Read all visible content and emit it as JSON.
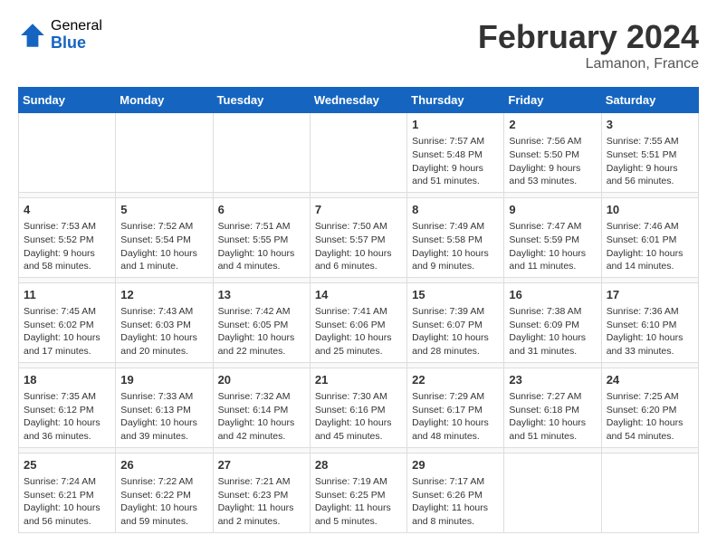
{
  "header": {
    "logo_general": "General",
    "logo_blue": "Blue",
    "title": "February 2024",
    "location": "Lamanon, France"
  },
  "columns": [
    "Sunday",
    "Monday",
    "Tuesday",
    "Wednesday",
    "Thursday",
    "Friday",
    "Saturday"
  ],
  "weeks": [
    {
      "days": [
        {
          "number": "",
          "info": ""
        },
        {
          "number": "",
          "info": ""
        },
        {
          "number": "",
          "info": ""
        },
        {
          "number": "",
          "info": ""
        },
        {
          "number": "1",
          "info": "Sunrise: 7:57 AM\nSunset: 5:48 PM\nDaylight: 9 hours\nand 51 minutes."
        },
        {
          "number": "2",
          "info": "Sunrise: 7:56 AM\nSunset: 5:50 PM\nDaylight: 9 hours\nand 53 minutes."
        },
        {
          "number": "3",
          "info": "Sunrise: 7:55 AM\nSunset: 5:51 PM\nDaylight: 9 hours\nand 56 minutes."
        }
      ]
    },
    {
      "days": [
        {
          "number": "4",
          "info": "Sunrise: 7:53 AM\nSunset: 5:52 PM\nDaylight: 9 hours\nand 58 minutes."
        },
        {
          "number": "5",
          "info": "Sunrise: 7:52 AM\nSunset: 5:54 PM\nDaylight: 10 hours\nand 1 minute."
        },
        {
          "number": "6",
          "info": "Sunrise: 7:51 AM\nSunset: 5:55 PM\nDaylight: 10 hours\nand 4 minutes."
        },
        {
          "number": "7",
          "info": "Sunrise: 7:50 AM\nSunset: 5:57 PM\nDaylight: 10 hours\nand 6 minutes."
        },
        {
          "number": "8",
          "info": "Sunrise: 7:49 AM\nSunset: 5:58 PM\nDaylight: 10 hours\nand 9 minutes."
        },
        {
          "number": "9",
          "info": "Sunrise: 7:47 AM\nSunset: 5:59 PM\nDaylight: 10 hours\nand 11 minutes."
        },
        {
          "number": "10",
          "info": "Sunrise: 7:46 AM\nSunset: 6:01 PM\nDaylight: 10 hours\nand 14 minutes."
        }
      ]
    },
    {
      "days": [
        {
          "number": "11",
          "info": "Sunrise: 7:45 AM\nSunset: 6:02 PM\nDaylight: 10 hours\nand 17 minutes."
        },
        {
          "number": "12",
          "info": "Sunrise: 7:43 AM\nSunset: 6:03 PM\nDaylight: 10 hours\nand 20 minutes."
        },
        {
          "number": "13",
          "info": "Sunrise: 7:42 AM\nSunset: 6:05 PM\nDaylight: 10 hours\nand 22 minutes."
        },
        {
          "number": "14",
          "info": "Sunrise: 7:41 AM\nSunset: 6:06 PM\nDaylight: 10 hours\nand 25 minutes."
        },
        {
          "number": "15",
          "info": "Sunrise: 7:39 AM\nSunset: 6:07 PM\nDaylight: 10 hours\nand 28 minutes."
        },
        {
          "number": "16",
          "info": "Sunrise: 7:38 AM\nSunset: 6:09 PM\nDaylight: 10 hours\nand 31 minutes."
        },
        {
          "number": "17",
          "info": "Sunrise: 7:36 AM\nSunset: 6:10 PM\nDaylight: 10 hours\nand 33 minutes."
        }
      ]
    },
    {
      "days": [
        {
          "number": "18",
          "info": "Sunrise: 7:35 AM\nSunset: 6:12 PM\nDaylight: 10 hours\nand 36 minutes."
        },
        {
          "number": "19",
          "info": "Sunrise: 7:33 AM\nSunset: 6:13 PM\nDaylight: 10 hours\nand 39 minutes."
        },
        {
          "number": "20",
          "info": "Sunrise: 7:32 AM\nSunset: 6:14 PM\nDaylight: 10 hours\nand 42 minutes."
        },
        {
          "number": "21",
          "info": "Sunrise: 7:30 AM\nSunset: 6:16 PM\nDaylight: 10 hours\nand 45 minutes."
        },
        {
          "number": "22",
          "info": "Sunrise: 7:29 AM\nSunset: 6:17 PM\nDaylight: 10 hours\nand 48 minutes."
        },
        {
          "number": "23",
          "info": "Sunrise: 7:27 AM\nSunset: 6:18 PM\nDaylight: 10 hours\nand 51 minutes."
        },
        {
          "number": "24",
          "info": "Sunrise: 7:25 AM\nSunset: 6:20 PM\nDaylight: 10 hours\nand 54 minutes."
        }
      ]
    },
    {
      "days": [
        {
          "number": "25",
          "info": "Sunrise: 7:24 AM\nSunset: 6:21 PM\nDaylight: 10 hours\nand 56 minutes."
        },
        {
          "number": "26",
          "info": "Sunrise: 7:22 AM\nSunset: 6:22 PM\nDaylight: 10 hours\nand 59 minutes."
        },
        {
          "number": "27",
          "info": "Sunrise: 7:21 AM\nSunset: 6:23 PM\nDaylight: 11 hours\nand 2 minutes."
        },
        {
          "number": "28",
          "info": "Sunrise: 7:19 AM\nSunset: 6:25 PM\nDaylight: 11 hours\nand 5 minutes."
        },
        {
          "number": "29",
          "info": "Sunrise: 7:17 AM\nSunset: 6:26 PM\nDaylight: 11 hours\nand 8 minutes."
        },
        {
          "number": "",
          "info": ""
        },
        {
          "number": "",
          "info": ""
        }
      ]
    }
  ]
}
